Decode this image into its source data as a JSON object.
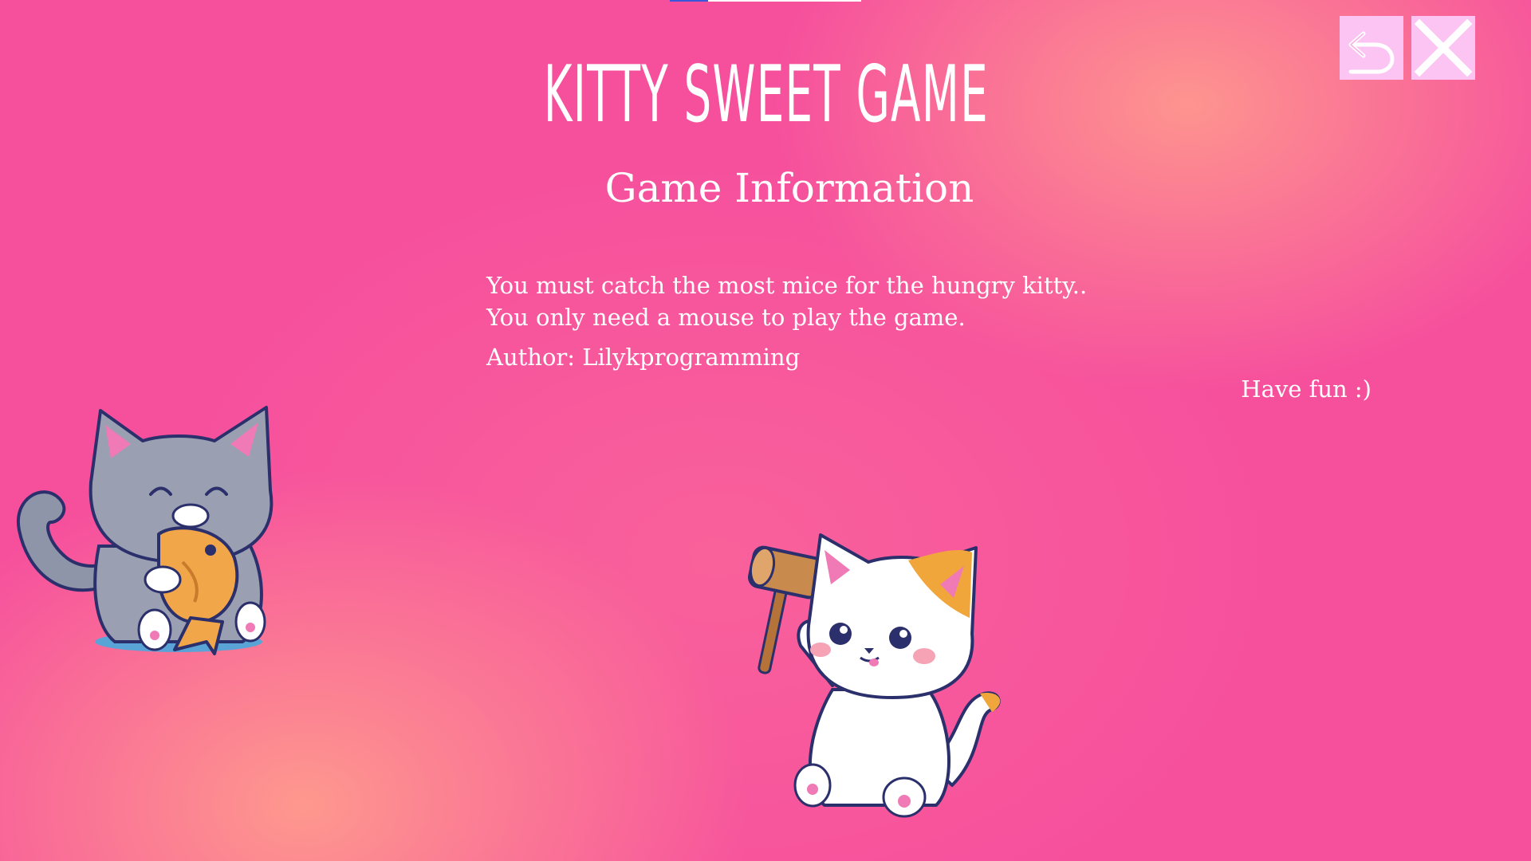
{
  "game": {
    "title": "KITTY SWEET GAME",
    "subtitle": "Game Information",
    "info_lines": [
      "You must catch the most mice for the hungry kitty..",
      "You only need a mouse to play the game."
    ],
    "author": "Author: Lilykprogramming",
    "farewell": "Have fun :)"
  },
  "controls": {
    "back_icon": "back-arrow-icon",
    "close_icon": "close-x-icon"
  },
  "colors": {
    "background": "#f6509d",
    "glow": "#ffa08c",
    "button_bg": "#fcc4f2",
    "text": "#ffffff"
  },
  "decorations": [
    "gray-cat-with-fish",
    "white-cat-with-hammer"
  ]
}
